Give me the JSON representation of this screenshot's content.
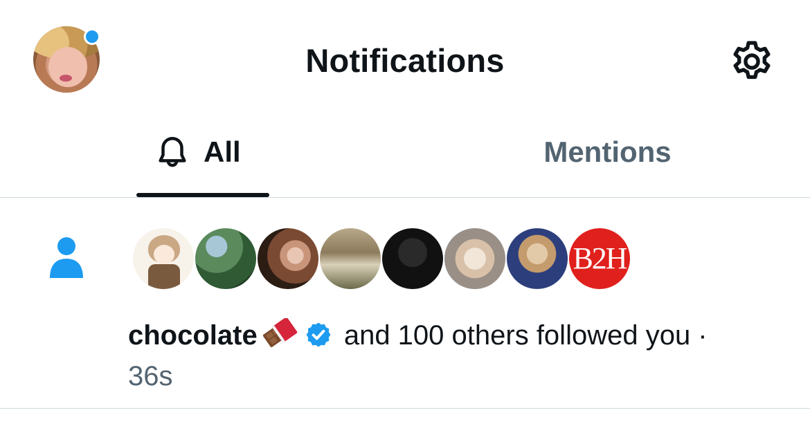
{
  "header": {
    "title": "Notifications",
    "profile_icon": "user-avatar",
    "settings_icon": "gear-icon",
    "unread_dot_color": "#1d9bf0"
  },
  "tabs": {
    "all": {
      "label": "All",
      "icon": "bell-icon",
      "active": true
    },
    "mentions": {
      "label": "Mentions",
      "active": false
    }
  },
  "notification": {
    "type_icon": "person-icon",
    "accent_color": "#1d9bf0",
    "avatars": [
      {
        "name": "chocolate"
      },
      {
        "name": "follower-2"
      },
      {
        "name": "follower-3"
      },
      {
        "name": "follower-4"
      },
      {
        "name": "follower-5"
      },
      {
        "name": "follower-6"
      },
      {
        "name": "follower-7"
      },
      {
        "name": "B2H",
        "label": "B2H",
        "color": "#e0201c"
      }
    ],
    "user_name": "chocolate",
    "name_emoji": "chocolate-bar-icon",
    "verified_icon": "verified-badge-icon",
    "message": " and 100 others followed you ·",
    "time": "36s"
  }
}
